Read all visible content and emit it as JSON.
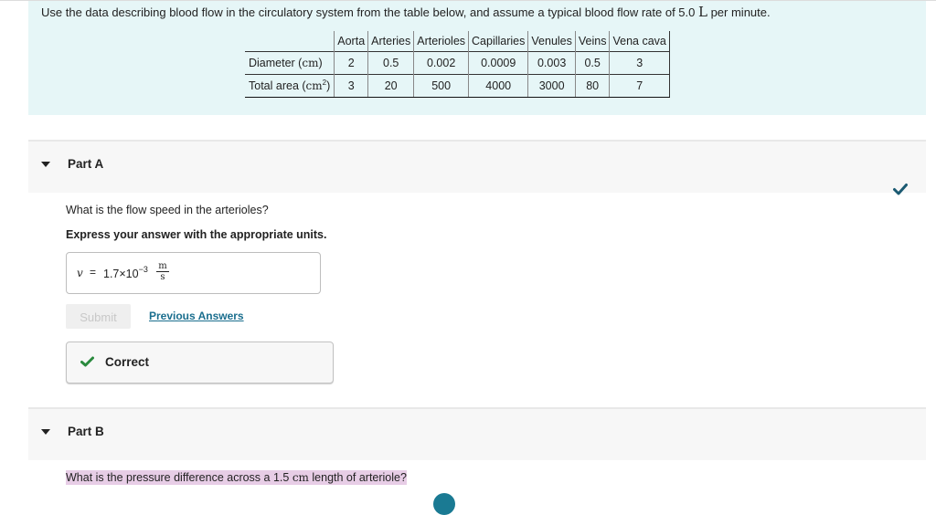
{
  "intro": {
    "text_before": "Use the data describing blood flow in the circulatory system from the table below, and assume a typical blood flow rate of 5.0 ",
    "unit": "L",
    "text_after": " per minute."
  },
  "table": {
    "columns": [
      "Aorta",
      "Arteries",
      "Arterioles",
      "Capillaries",
      "Venules",
      "Veins",
      "Vena cava"
    ],
    "rows": [
      {
        "label": "Diameter (",
        "unit": "cm",
        "unit_sup": "",
        "label_end": ")",
        "values": [
          "2",
          "0.5",
          "0.002",
          "0.0009",
          "0.003",
          "0.5",
          "3"
        ]
      },
      {
        "label": "Total area (",
        "unit": "cm",
        "unit_sup": "2",
        "label_end": ")",
        "values": [
          "3",
          "20",
          "500",
          "4000",
          "3000",
          "80",
          "7"
        ]
      }
    ]
  },
  "partA": {
    "title": "Part A",
    "question": "What is the flow speed in the arterioles?",
    "instruction": "Express your answer with the appropriate units.",
    "answer": {
      "variable": "v",
      "equals": "=",
      "mantissa": "1.7×10",
      "exponent": "−3",
      "unit_numerator": "m",
      "unit_denominator": "s"
    },
    "submit_label": "Submit",
    "previous_answers_label": "Previous Answers",
    "feedback": "Correct",
    "status": "completed"
  },
  "partB": {
    "title": "Part B",
    "question_before": "What is the pressure difference across a 1.5 ",
    "question_unit": "cm",
    "question_after": " length of arteriole?"
  },
  "colors": {
    "intro_bg": "#e6f6f7",
    "link": "#1a6e8e",
    "check_teal": "#1b5a72",
    "check_green": "#2a8a3e",
    "highlight": "#e7cde6"
  }
}
